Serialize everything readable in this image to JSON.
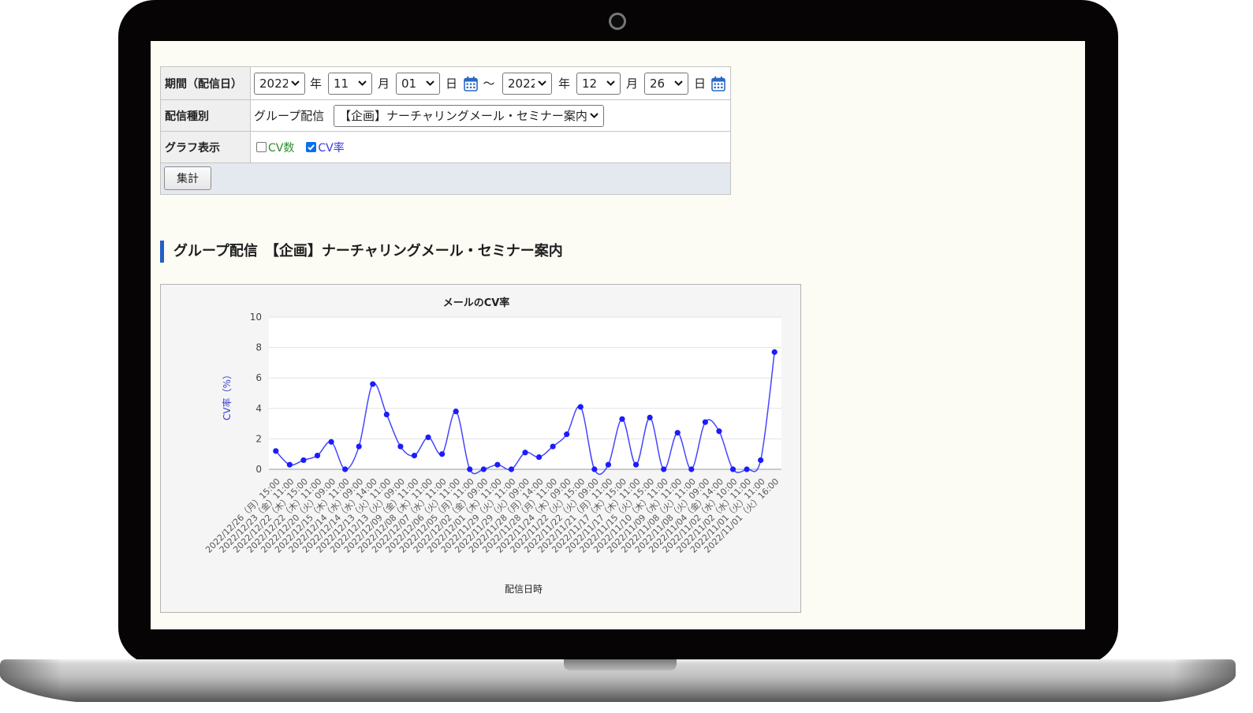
{
  "form": {
    "period": {
      "label": "期間（配信日）",
      "start_year": "2022",
      "start_month": "11",
      "start_day": "01",
      "end_year": "2022",
      "end_month": "12",
      "end_day": "26",
      "unit_year": "年",
      "unit_month": "月",
      "unit_day": "日",
      "separator": "～"
    },
    "delivery_type": {
      "label": "配信種別",
      "text": "グループ配信",
      "selected": "【企画】ナーチャリングメール・セミナー案内"
    },
    "graph_display": {
      "label": "グラフ表示",
      "options": [
        {
          "label": "CV数",
          "checked": false
        },
        {
          "label": "CV率",
          "checked": true
        }
      ]
    },
    "submit_label": "集計"
  },
  "section_title": "グループ配信　【企画】ナーチャリングメール・セミナー案内",
  "icons": {
    "calendar": "calendar-icon",
    "dropdown": "chevron-down-icon",
    "camera": "camera-icon"
  },
  "colors": {
    "accent": "#2160c4",
    "calendar_icon": "#2a68c6",
    "cv_count_text": "#2e8b2e",
    "cv_rate_text": "#3a3ad8",
    "checkbox_checked": "#0b6fe8",
    "series_line": "#4646ff",
    "series_point": "#1c1cff",
    "ylabel": "#3c3cdc"
  },
  "chart_data": {
    "type": "line",
    "title": "メールのCV率",
    "xlabel": "配信日時",
    "ylabel": "CV率（%）",
    "ylim": [
      0,
      10
    ],
    "yticks": [
      0,
      2,
      4,
      6,
      8,
      10
    ],
    "grid": true,
    "smooth": true,
    "categories": [
      "2022/12/26（月）15:00",
      "2022/12/23（金）11:00",
      "2022/12/22（木）15:00",
      "2022/12/22（木）11:00",
      "2022/12/20（火）09:00",
      "2022/12/15（木）11:00",
      "2022/12/14（水）09:00",
      "2022/12/14（水）14:00",
      "2022/12/13（火）11:00",
      "2022/12/13（火）09:00",
      "2022/12/09（金）11:00",
      "2022/12/08（木）11:00",
      "2022/12/07（水）11:00",
      "2022/12/06（火）11:00",
      "2022/12/05（月）11:00",
      "2022/12/02（金）09:00",
      "2022/12/01（木）11:00",
      "2022/11/29（火）11:00",
      "2022/11/29（火）09:00",
      "2022/11/28（月）14:00",
      "2022/11/28（月）11:00",
      "2022/11/24（木）09:00",
      "2022/11/22（火）15:00",
      "2022/11/22（火）09:00",
      "2022/11/21（月）11:00",
      "2022/11/17（木）15:00",
      "2022/11/17（木）11:00",
      "2022/11/15（火）15:00",
      "2022/11/10（木）11:00",
      "2022/11/09（水）11:00",
      "2022/11/08（火）11:00",
      "2022/11/08（火）09:00",
      "2022/11/04（金）14:00",
      "2022/11/02（水）10:00",
      "2022/11/02（水）11:00",
      "2022/11/01（火）11:00",
      "2022/11/01（火）16:00"
    ],
    "series": [
      {
        "values": [
          1.2,
          0.3,
          0.6,
          0.9,
          1.8,
          0,
          1.5,
          5.6,
          3.6,
          1.5,
          0.9,
          2.1,
          1.0,
          3.8,
          0,
          0,
          0.3,
          0,
          1.1,
          0.8,
          1.5,
          2.3,
          4.1,
          0,
          0.3,
          3.3,
          0.3,
          3.4,
          0,
          2.4,
          0,
          3.1,
          2.5,
          0,
          0,
          0.6,
          7.7
        ]
      }
    ]
  }
}
